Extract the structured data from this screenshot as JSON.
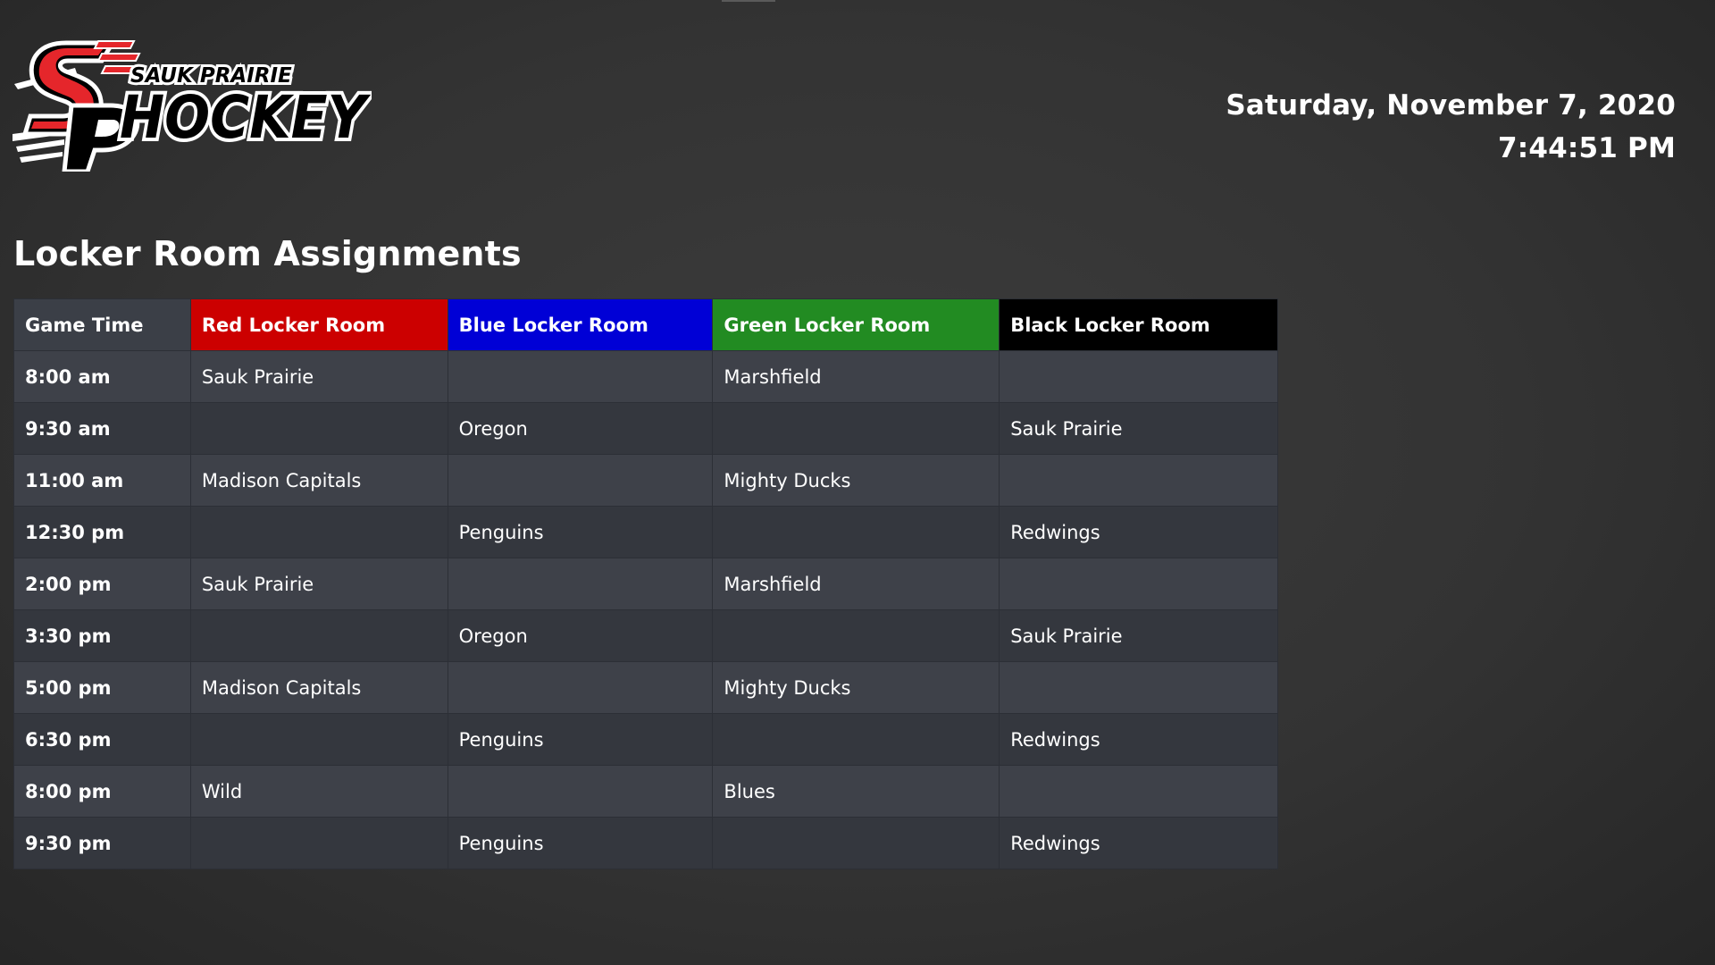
{
  "header": {
    "logo_line1": "SAUK PRAIRIE",
    "logo_line2": "HOCKEY",
    "logo_mark": "SP",
    "date": "Saturday, November 7, 2020",
    "time": "7:44:51 PM"
  },
  "main": {
    "title": "Locker Room Assignments"
  },
  "colors": {
    "red_room": "#cc0000",
    "blue_room": "#0000d6",
    "green_room": "#228b22",
    "black_room": "#000000",
    "logo_red": "#e5262b"
  },
  "table": {
    "columns": [
      {
        "label": "Game Time"
      },
      {
        "label": "Red Locker Room",
        "color": "#cc0000"
      },
      {
        "label": "Blue Locker Room",
        "color": "#0000d6"
      },
      {
        "label": "Green Locker Room",
        "color": "#228b22"
      },
      {
        "label": "Black Locker Room",
        "color": "#000000"
      }
    ],
    "rows": [
      {
        "time": "8:00 am",
        "red": "Sauk Prairie",
        "blue": "",
        "green": "Marshfield",
        "black": ""
      },
      {
        "time": "9:30 am",
        "red": "",
        "blue": "Oregon",
        "green": "",
        "black": "Sauk Prairie"
      },
      {
        "time": "11:00 am",
        "red": "Madison Capitals",
        "blue": "",
        "green": "Mighty Ducks",
        "black": ""
      },
      {
        "time": "12:30 pm",
        "red": "",
        "blue": "Penguins",
        "green": "",
        "black": "Redwings"
      },
      {
        "time": "2:00 pm",
        "red": "Sauk Prairie",
        "blue": "",
        "green": "Marshfield",
        "black": ""
      },
      {
        "time": "3:30 pm",
        "red": "",
        "blue": "Oregon",
        "green": "",
        "black": "Sauk Prairie"
      },
      {
        "time": "5:00 pm",
        "red": "Madison Capitals",
        "blue": "",
        "green": "Mighty Ducks",
        "black": ""
      },
      {
        "time": "6:30 pm",
        "red": "",
        "blue": "Penguins",
        "green": "",
        "black": "Redwings"
      },
      {
        "time": "8:00 pm",
        "red": "Wild",
        "blue": "",
        "green": "Blues",
        "black": ""
      },
      {
        "time": "9:30 pm",
        "red": "",
        "blue": "Penguins",
        "green": "",
        "black": "Redwings"
      }
    ]
  }
}
